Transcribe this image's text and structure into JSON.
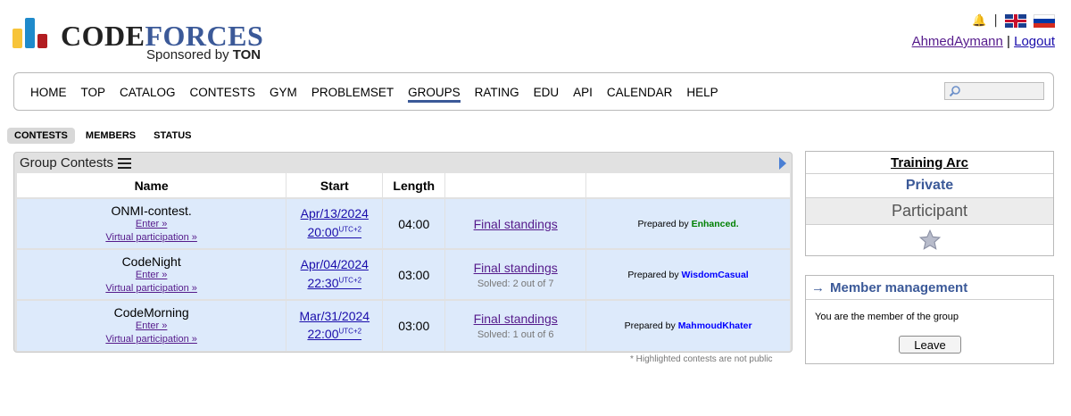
{
  "header": {
    "logo_code": "CODE",
    "logo_forces": "FORCES",
    "sponsored_prefix": "Sponsored by",
    "sponsor_name": "TON",
    "separator": "|",
    "username": "AhmedAymann",
    "logout": "Logout"
  },
  "menu": {
    "items": [
      "HOME",
      "TOP",
      "CATALOG",
      "CONTESTS",
      "GYM",
      "PROBLEMSET",
      "GROUPS",
      "RATING",
      "EDU",
      "API",
      "CALENDAR",
      "HELP"
    ],
    "active": "GROUPS",
    "search_placeholder": ""
  },
  "subtabs": {
    "contests": "CONTESTS",
    "members": "MEMBERS",
    "status": "STATUS"
  },
  "panel": {
    "caption": "Group Contests",
    "columns": {
      "name": "Name",
      "start": "Start",
      "length": "Length",
      "standings": "",
      "author": ""
    },
    "rows": [
      {
        "name": "ONMI-contest.",
        "enter": "Enter »",
        "virtual": "Virtual participation »",
        "start_date": "Apr/13/2024",
        "start_time": "20:00",
        "tz": "UTC+2",
        "length": "04:00",
        "standings": "Final standings",
        "solved": "",
        "prepared_by": "Prepared by",
        "author": "Enhanced."
      },
      {
        "name": "CodeNight",
        "enter": "Enter »",
        "virtual": "Virtual participation »",
        "start_date": "Apr/04/2024",
        "start_time": "22:30",
        "tz": "UTC+2",
        "length": "03:00",
        "standings": "Final standings",
        "solved": "Solved: 2 out of 7",
        "prepared_by": "Prepared by",
        "author": "WisdomCasual"
      },
      {
        "name": "CodeMorning",
        "enter": "Enter »",
        "virtual": "Virtual participation »",
        "start_date": "Mar/31/2024",
        "start_time": "22:00",
        "tz": "UTC+2",
        "length": "03:00",
        "standings": "Final standings",
        "solved": "Solved: 1 out of 6",
        "prepared_by": "Prepared by",
        "author": "MahmoudKhater"
      }
    ],
    "footnote": "* Highlighted contests are not public"
  },
  "group": {
    "title": "Training Arc",
    "visibility": "Private",
    "role": "Participant"
  },
  "member_management": {
    "arrow": "→",
    "title": "Member management",
    "text": "You are the member of the group",
    "leave": "Leave"
  },
  "colors": {
    "brand_blue": "#3b5998",
    "row_bg": "#ddeafb",
    "author_green": "#008000",
    "author_blue": "#0000ff"
  }
}
